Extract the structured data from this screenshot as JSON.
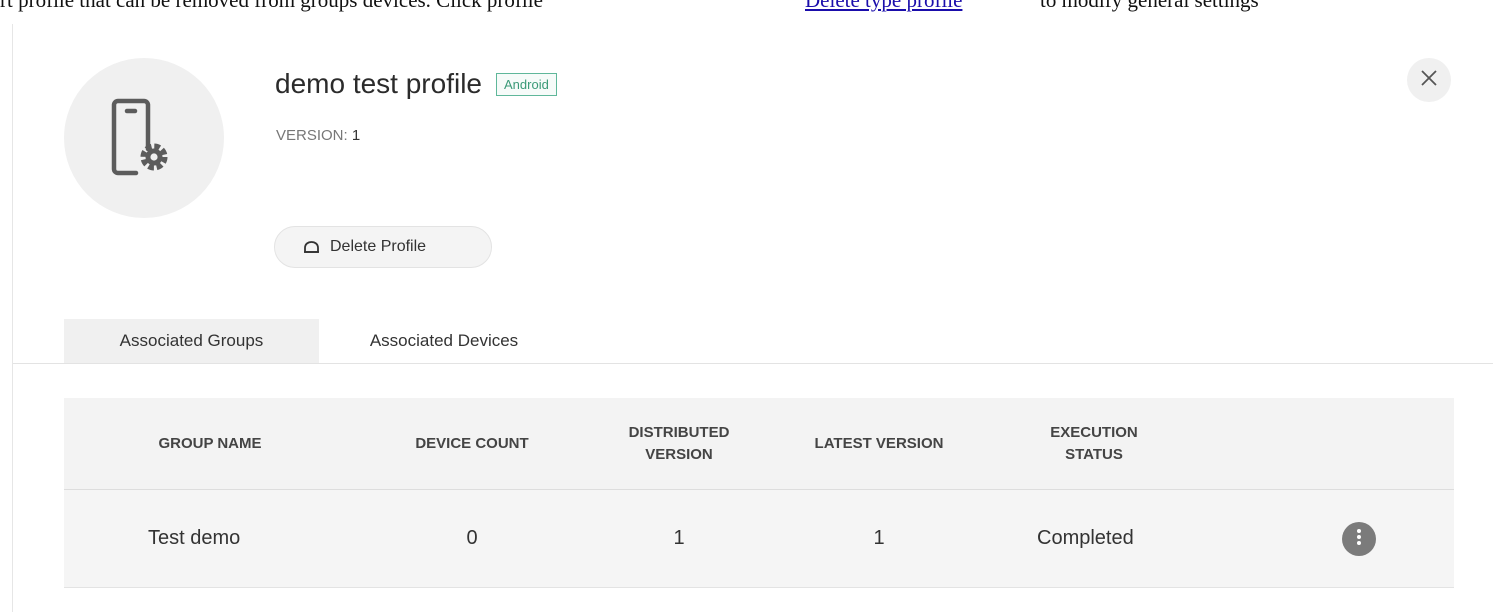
{
  "top_strip": {
    "pre_text": "rt profile that can be removed from groups devices. Click profile",
    "link_text": "Delete type profile",
    "post_text": "to modify general settings"
  },
  "profile": {
    "title": "demo test profile",
    "platform": "Android",
    "version_label": "VERSION:",
    "version_value": "1",
    "icon": "device-settings-icon"
  },
  "actions": {
    "delete_label": "Delete Profile",
    "delete_icon": "trash-icon",
    "close_icon": "close-icon"
  },
  "tabs": [
    {
      "label": "Associated Groups",
      "active": true
    },
    {
      "label": "Associated Devices",
      "active": false
    }
  ],
  "table": {
    "headers": {
      "group_name": "GROUP NAME",
      "device_count": "DEVICE COUNT",
      "distributed_version": "DISTRIBUTED VERSION",
      "latest_version": "LATEST VERSION",
      "execution_status": "EXECUTION STATUS"
    },
    "rows": [
      {
        "group_name": "Test demo",
        "device_count": "0",
        "distributed_version": "1",
        "latest_version": "1",
        "execution_status": "Completed",
        "action_icon": "more-vertical-icon"
      }
    ]
  },
  "colors": {
    "badge_border": "#5fb79a",
    "badge_text": "#3b9a78",
    "link": "#1a0dab",
    "more_button": "#7b7b7b"
  }
}
